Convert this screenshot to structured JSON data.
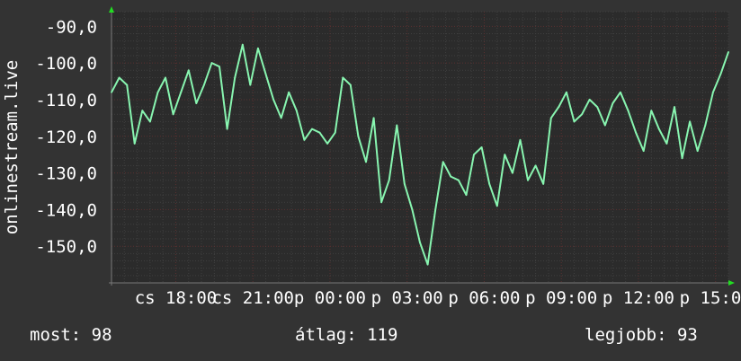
{
  "chart_data": {
    "type": "line",
    "ylabel": "onlinestream.live",
    "ylim": [
      -160,
      -86
    ],
    "yticks": [
      -150,
      -140,
      -130,
      -120,
      -110,
      -100,
      -90
    ],
    "ytick_labels": [
      "-150,0",
      "-140,0",
      "-130,0",
      "-120,0",
      "-110,0",
      "-100,0",
      "-90,0"
    ],
    "x_range": [
      15.5,
      39.5
    ],
    "xticks": [
      18,
      21,
      24,
      27,
      30,
      33,
      36,
      39
    ],
    "xtick_labels": [
      "cs 18:00",
      "cs 21:00",
      "p 00:00",
      "p 03:00",
      "p 06:00",
      "p 09:00",
      "p 12:00",
      "p 15:00"
    ],
    "grid": true,
    "colors": {
      "background": "#333333",
      "plot_background": "#2b2b2b",
      "line": "#88f5b0",
      "grid_minor": "#3f3f3f",
      "grid_major": "#5a3030",
      "axis": "#7a7a7a",
      "arrow": "#22dd22"
    },
    "series": [
      {
        "x": [
          15.5,
          15.8,
          16.1,
          16.4,
          16.7,
          17.0,
          17.3,
          17.6,
          17.9,
          18.2,
          18.5,
          18.8,
          19.1,
          19.4,
          19.7,
          20.0,
          20.3,
          20.6,
          20.9,
          21.2,
          21.5,
          21.8,
          22.1,
          22.4,
          22.7,
          23.0,
          23.3,
          23.6,
          23.9,
          24.2,
          24.5,
          24.8,
          25.1,
          25.4,
          25.7,
          26.0,
          26.3,
          26.6,
          26.9,
          27.2,
          27.5,
          27.8,
          28.1,
          28.4,
          28.7,
          29.0,
          29.3,
          29.6,
          29.9,
          30.2,
          30.5,
          30.8,
          31.1,
          31.4,
          31.7,
          32.0,
          32.3,
          32.6,
          32.9,
          33.2,
          33.5,
          33.8,
          34.1,
          34.4,
          34.7,
          35.0,
          35.3,
          35.6,
          35.9,
          36.2,
          36.5,
          36.8,
          37.1,
          37.4,
          37.7,
          38.0,
          38.3,
          38.6,
          38.9,
          39.2,
          39.5
        ],
        "values": [
          -108,
          -104,
          -106,
          -122,
          -113,
          -116,
          -108,
          -104,
          -114,
          -108,
          -102,
          -111,
          -106,
          -100,
          -101,
          -118,
          -104,
          -95,
          -106,
          -96,
          -103,
          -110,
          -115,
          -108,
          -113,
          -121,
          -118,
          -119,
          -122,
          -119,
          -104,
          -106,
          -120,
          -127,
          -115,
          -138,
          -132,
          -117,
          -133,
          -140,
          -149,
          -155,
          -140,
          -127,
          -131,
          -132,
          -136,
          -125,
          -123,
          -133,
          -139,
          -125,
          -130,
          -121,
          -132,
          -128,
          -133,
          -115,
          -112,
          -108,
          -116,
          -114,
          -110,
          -112,
          -117,
          -111,
          -108,
          -113,
          -119,
          -124,
          -113,
          -118,
          -122,
          -112,
          -126,
          -116,
          -124,
          -117,
          -108,
          -103,
          -97
        ]
      }
    ]
  },
  "stats": {
    "now": "most: 98",
    "avg": "átlag: 119",
    "best": "legjobb: 93"
  }
}
